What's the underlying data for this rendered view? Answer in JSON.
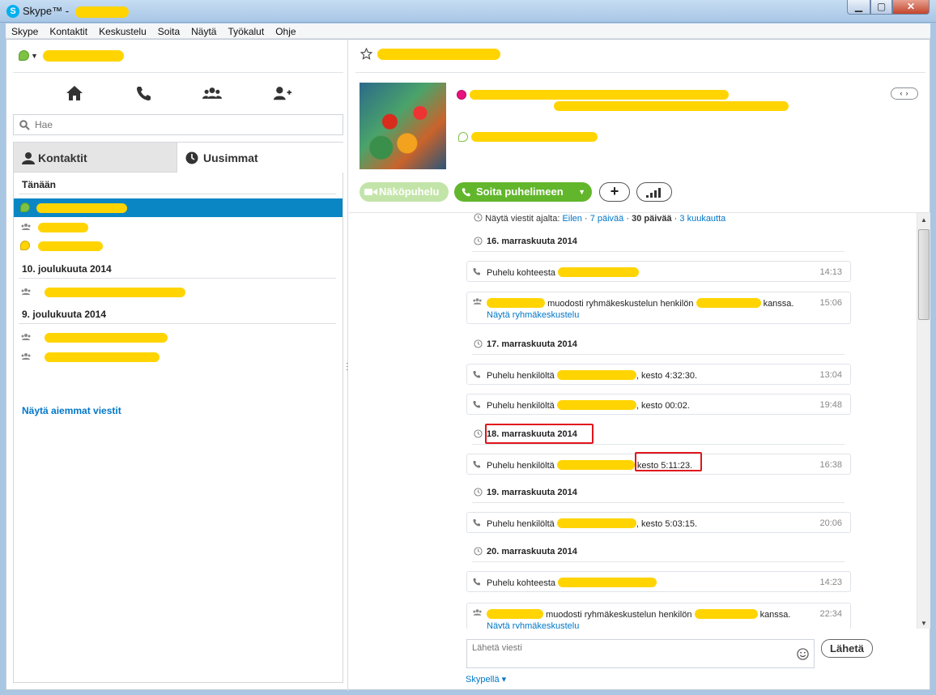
{
  "window": {
    "title": "Skype™ - "
  },
  "menu": [
    "Skype",
    "Kontaktit",
    "Keskustelu",
    "Soita",
    "Näytä",
    "Työkalut",
    "Ohje"
  ],
  "search": {
    "placeholder": "Hae"
  },
  "tabs": {
    "contacts": "Kontaktit",
    "recent": "Uusimmat"
  },
  "recent": {
    "groups": [
      "Tänään",
      "10. joulukuuta 2014",
      "9. joulukuuta 2014"
    ],
    "older_link": "Näytä aiemmat viestit"
  },
  "actions": {
    "video": "Näköpuhelu",
    "call": "Soita puhelimeen",
    "add": "+"
  },
  "filter": {
    "label": "Näytä viestit ajalta:",
    "options": [
      "Eilen",
      "7 päivää",
      "30 päivää",
      "3 kuukautta"
    ],
    "selected": "30 päivää"
  },
  "history": {
    "d1": "16. marraskuuta 2014",
    "m1": {
      "text": "Puhelu kohteesta",
      "time": "14:13"
    },
    "m2": {
      "text_mid": "muodosti ryhmäkeskustelun henkilön",
      "text_end": "kanssa.",
      "link": "Näytä ryhmäkeskustelu",
      "time": "15:06"
    },
    "d2": "17. marraskuuta 2014",
    "m3": {
      "text": "Puhelu henkilöltä",
      "duration": ", kesto 4:32:30.",
      "time": "13:04"
    },
    "m4": {
      "text": "Puhelu henkilöltä",
      "duration": ", kesto 00:02.",
      "time": "19:48"
    },
    "d3": "18. marraskuuta 2014",
    "m5": {
      "text": "Puhelu henkilöltä",
      "duration": "kesto 5:11:23.",
      "time": "16:38"
    },
    "d4": "19. marraskuuta 2014",
    "m6": {
      "text": "Puhelu henkilöltä",
      "duration": ", kesto 5:03:15.",
      "time": "20:06"
    },
    "d5": "20. marraskuuta 2014",
    "m7": {
      "text": "Puhelu kohteesta",
      "time": "14:23"
    },
    "m8": {
      "text_mid": "muodosti ryhmäkeskustelun henkilön",
      "text_end": "kanssa.",
      "link": "Näytä ryhmäkeskustelu",
      "time": "22:34"
    }
  },
  "compose": {
    "placeholder": "Lähetä viesti",
    "send": "Lähetä",
    "method": "Skypellä ▾"
  },
  "colors": {
    "skype_blue": "#00aff0",
    "call_green": "#62b62c",
    "selection": "#0a86c5",
    "link": "#0077c8",
    "redaction": "#ffd400",
    "annotation": "#e0151c"
  }
}
